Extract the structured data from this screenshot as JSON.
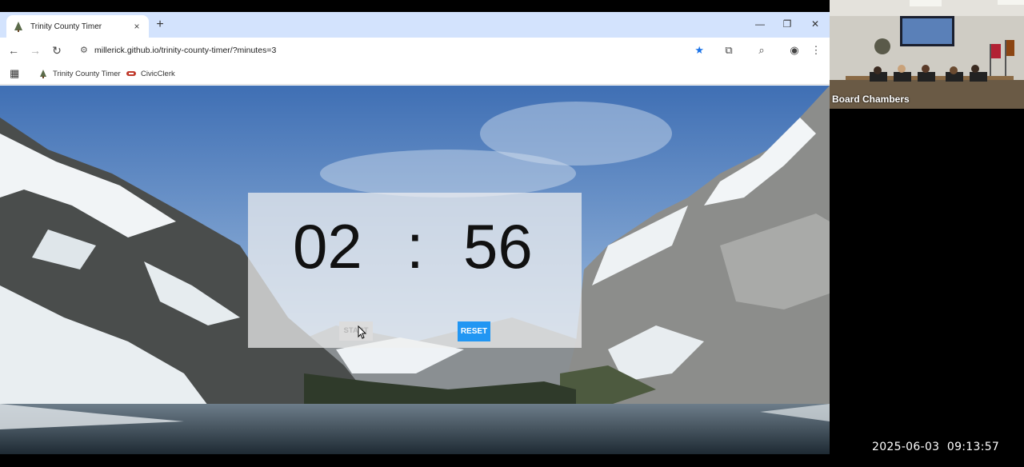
{
  "browser": {
    "tab": {
      "title": "Trinity County Timer",
      "close_icon": "×"
    },
    "new_tab_icon": "+",
    "window_controls": {
      "minimize": "—",
      "restore": "❐",
      "close": "✕"
    },
    "nav": {
      "back": "←",
      "forward": "→",
      "reload": "↻"
    },
    "address_bar": {
      "url": "millerick.github.io/trinity-county-timer/?minutes=3",
      "site_info_icon": "⚙",
      "bookmark_icon": "★"
    },
    "toolbar_icons": {
      "extensions": "⧉",
      "cast": "⌕",
      "profile": "◉",
      "menu": "⋮"
    },
    "bookmarks": [
      {
        "label": "Trinity County Timer",
        "icon": "tree-icon"
      },
      {
        "label": "CivicClerk",
        "icon": "civicclerk-icon"
      }
    ],
    "apps_icon": "▦"
  },
  "timer": {
    "minutes": "02",
    "separator": ":",
    "seconds": "56",
    "start_label": "START",
    "reset_label": "RESET",
    "reset_color": "#2196f3"
  },
  "video": {
    "label": "Board Chambers",
    "timestamp": "2025-06-03  09:13:57"
  }
}
